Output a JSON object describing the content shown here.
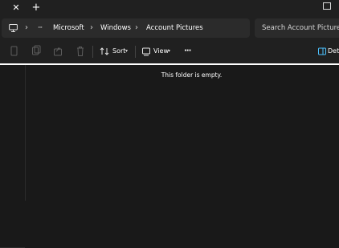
{
  "titlebar": {
    "close_tab_glyph": "✕",
    "new_tab_glyph": "+"
  },
  "address": {
    "overflow": "···",
    "crumbs": [
      "Microsoft",
      "Windows",
      "Account Pictures"
    ]
  },
  "search": {
    "placeholder": "Search Account Pictures"
  },
  "toolbar": {
    "sort_label": "Sort",
    "view_label": "View",
    "more_label": "···",
    "details_label": "Det"
  },
  "content": {
    "empty_message": "This folder is empty."
  },
  "colors": {
    "background": "#191919",
    "chrome": "#202020",
    "field": "#2b2b2b",
    "details_icon": "#4cc2ff"
  }
}
